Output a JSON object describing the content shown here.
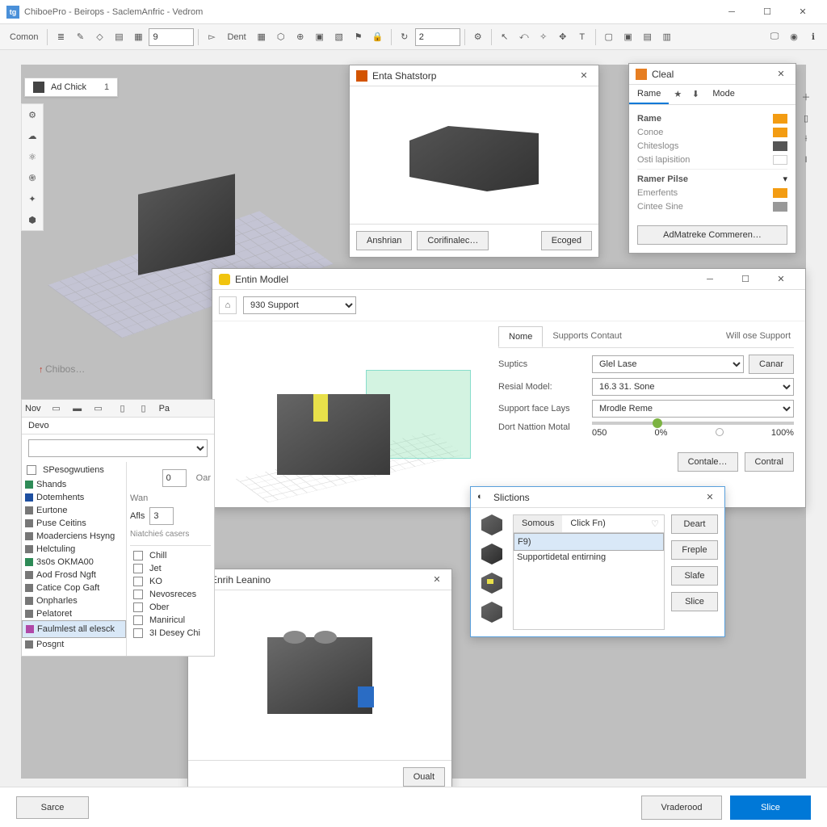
{
  "window": {
    "title": "ChiboePro - Beirops - SaclemAnfric - Vedrom"
  },
  "toolbar": {
    "canvas": "Comon",
    "num1": "9",
    "dent": "Dent",
    "num2": "2"
  },
  "tag": {
    "label": "Ad Chick",
    "num": "1"
  },
  "watermark": "Chibos…",
  "panel_shatstorp": {
    "title": "Enta Shatstorp",
    "btn1": "Anshrian",
    "btn2": "Corifinalec…",
    "btn3": "Ecoged"
  },
  "panel_cleal": {
    "title": "Cleal",
    "tab_rame": "Rame",
    "tab_mode": "Mode",
    "rows": [
      "Rame",
      "Conoe",
      "Chiteslogs",
      "Osti lapisition",
      "Ramer Pilse",
      "Emerfents",
      "Cintee Sine"
    ],
    "btn": "AdMatreke Commeren…"
  },
  "panel_model": {
    "title": "Entin Modlel",
    "select": "930 Support",
    "tab_name": "Nome",
    "tab_supports": "Supports Contaut",
    "will": "Will ose Support",
    "f1": {
      "lbl": "Suptics",
      "val": "Glel Lase",
      "btn": "Canar"
    },
    "f2": {
      "lbl": "Resial Model:",
      "val": "16.3 31. Sone"
    },
    "f3": {
      "lbl": "Support face Lays",
      "val": "Mrodle Reme"
    },
    "f4": {
      "lbl": "Dort Nattion Motal",
      "v0": "050",
      "v1": "0%",
      "v2": "100%"
    },
    "btn_a": "Contale…",
    "btn_b": "Contral"
  },
  "panel_slictions": {
    "title": "Slictions",
    "tab1": "Somous",
    "tab2": "Click Fn)",
    "items": [
      "F9)",
      "Supportidetal entirning"
    ],
    "btns": [
      "Deart",
      "Freple",
      "Slafe",
      "Slice"
    ]
  },
  "panel_leaning": {
    "title": "Enrih Leanino",
    "btn": "Oualt"
  },
  "left_panel": {
    "nav": [
      "Nov",
      "Pa"
    ],
    "devo": "Devo",
    "spinner": "0",
    "side": "Oar",
    "group": "SPesogwutiens",
    "wan": "Wan",
    "afls": "Afls",
    "afls_v": "3",
    "niat": "Niatchieś casers",
    "cats": [
      "Shands",
      "Dotemhents",
      "Eurtone",
      "Puse Ceitins",
      "Moaderciens Hsyng",
      "Helctuling",
      "3s0s OKMA00",
      "Aod Frosd Ngft",
      "Catice Cop Gaft",
      "Onpharles",
      "Pelatoret",
      "Faulmlest all elesck",
      "Posgnt"
    ],
    "chks": [
      "Chill",
      "Jet",
      "KO",
      "Nevosreces",
      "Ober",
      "Maniricul",
      "3I Desey Chi"
    ]
  },
  "footer": {
    "sarce": "Sarce",
    "vraderood": "Vraderood",
    "slice": "Slice"
  }
}
